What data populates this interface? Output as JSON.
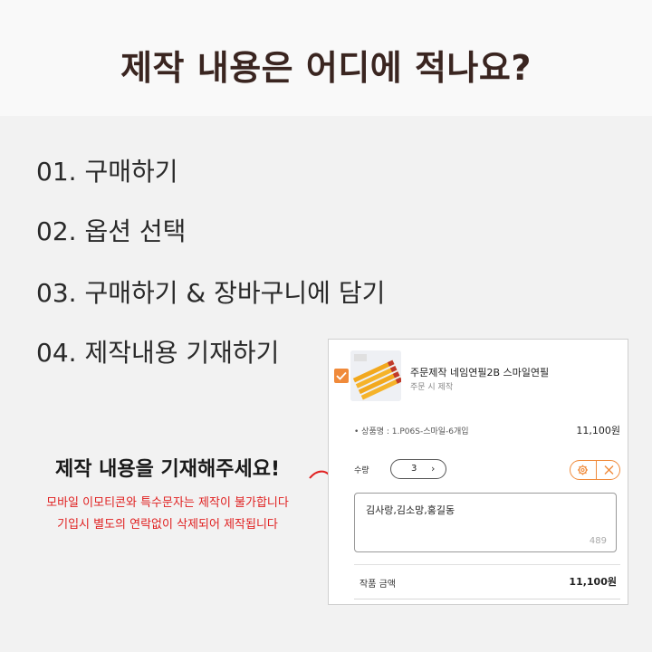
{
  "header": {
    "title": "제작 내용은 어디에 적나요?"
  },
  "steps": [
    {
      "num": "01.",
      "label": "구매하기"
    },
    {
      "num": "02.",
      "label": "옵션 선택"
    },
    {
      "num": "03.",
      "label": "구매하기 & 장바구니에 담기"
    },
    {
      "num": "04.",
      "label": "제작내용 기재하기"
    }
  ],
  "cta": {
    "title": "제작 내용을 기재해주세요!",
    "notes": [
      "모바일 이모티콘와 특수문자는 제작이 불가합니다",
      "기입시 별도의 연락없이 삭제되어 제작됩니다"
    ]
  },
  "card": {
    "product_name": "주문제작 네임연필2B 스마일연필",
    "product_sub": "주문 시 제작",
    "option_text": "• 상품명 : 1.P06S-스마일-6개입",
    "option_price": "11,100원",
    "qty_label": "수량",
    "qty_value": "3",
    "qty_next": "›",
    "textarea_value": "김사랑,김소망,홍길동",
    "char_count": "489",
    "total_label": "작품 금액",
    "total_value": "11,100원"
  },
  "colors": {
    "accent": "#f08a3a",
    "notice": "#e02020",
    "title": "#3a2520"
  },
  "icons": [
    "check-icon",
    "gear-icon",
    "close-icon",
    "curved-arrow-icon",
    "chevron-right-icon"
  ]
}
